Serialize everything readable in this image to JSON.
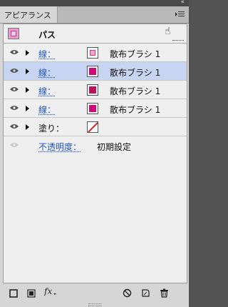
{
  "panel": {
    "tab_label": "アピアランス",
    "collapse_glyph": "«"
  },
  "header": {
    "title": "パス"
  },
  "rows": [
    {
      "label": "線：",
      "value": "散布ブラシ 1",
      "swatch_color": "#f0a8d2"
    },
    {
      "label": "線：",
      "value": "散布ブラシ 1",
      "swatch_color": "#d10a78"
    },
    {
      "label": "線：",
      "value": "散布ブラシ 1",
      "swatch_color": "#c0125a"
    },
    {
      "label": "線：",
      "value": "散布ブラシ 1",
      "swatch_color": "#d10a78"
    }
  ],
  "fill_row": {
    "label": "塗り："
  },
  "opacity_row": {
    "label": "不透明度：",
    "value": "初期設定"
  },
  "colors": {
    "selection": "#c7d5f2",
    "link": "#2456c8"
  }
}
